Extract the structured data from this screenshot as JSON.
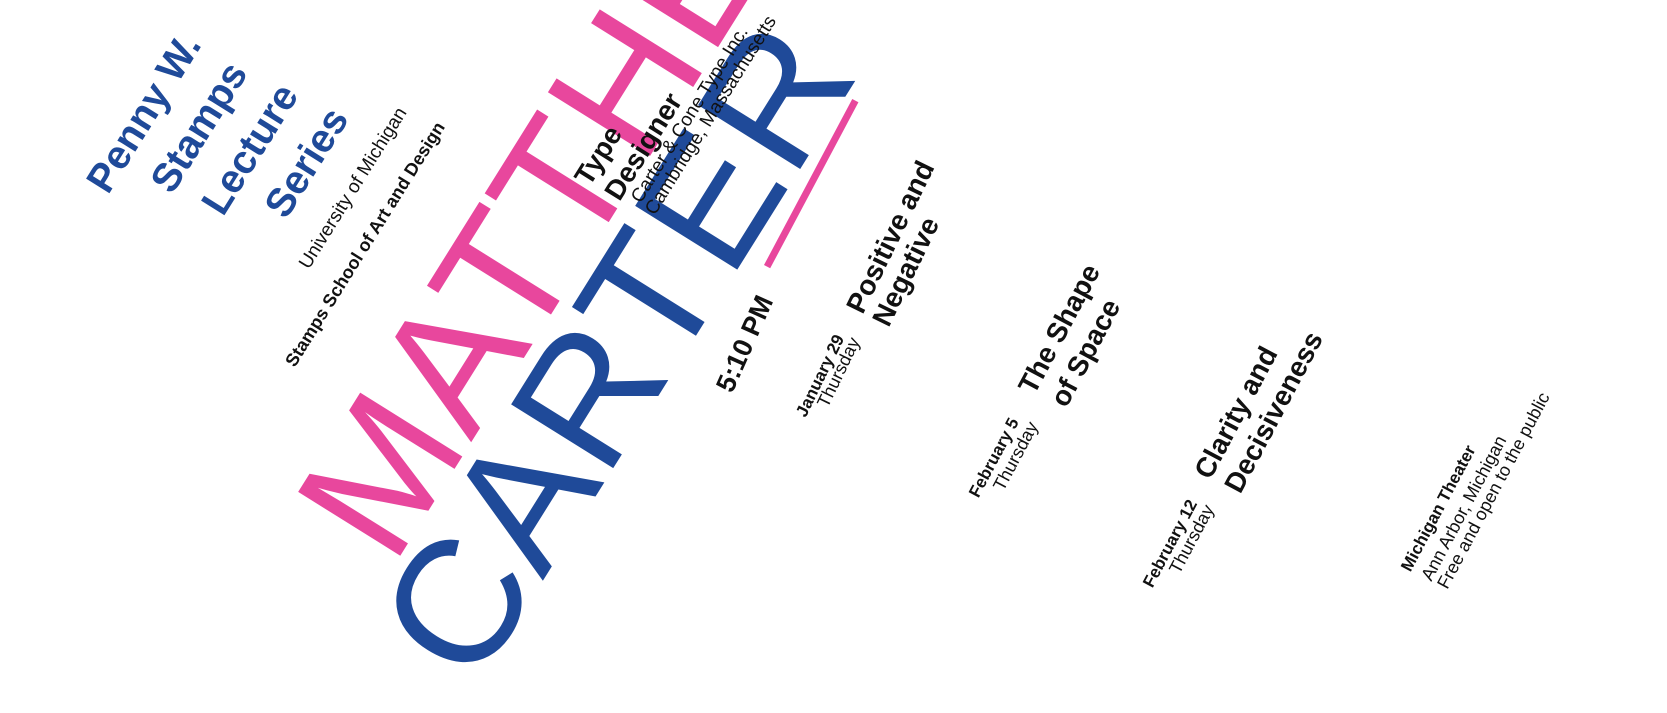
{
  "series": {
    "line1": "Penny W.",
    "line2": "Stamps",
    "line3": "Lecture",
    "line4": "Series"
  },
  "school": {
    "university": "University of Michigan",
    "school_name": "Stamps School of Art and Design"
  },
  "speaker": {
    "first_name": "MATTHEW",
    "last_name": "CARTER",
    "role_line1": "Type",
    "role_line2": "Designer",
    "company": "Carter & Cone Type Inc.",
    "location": "Cambridge, Massachusetts"
  },
  "time": "5:10 PM",
  "lectures": [
    {
      "title_line1": "Positive and",
      "title_line2": "Negative",
      "date": "January 29",
      "day": "Thursday"
    },
    {
      "title_line1": "The Shape",
      "title_line2": "of Space",
      "date": "February 5",
      "day": "Thursday"
    },
    {
      "title_line1": "Clarity and",
      "title_line2": "Decisiveness",
      "date": "February 12",
      "day": "Thursday"
    }
  ],
  "venue": {
    "name": "Michigan Theater",
    "city": "Ann Arbor, Michigan",
    "note": "Free and open to the public"
  },
  "colors": {
    "blue": "#1f4a99",
    "pink": "#e8479d",
    "text": "#111111",
    "background": "#ffffff"
  }
}
